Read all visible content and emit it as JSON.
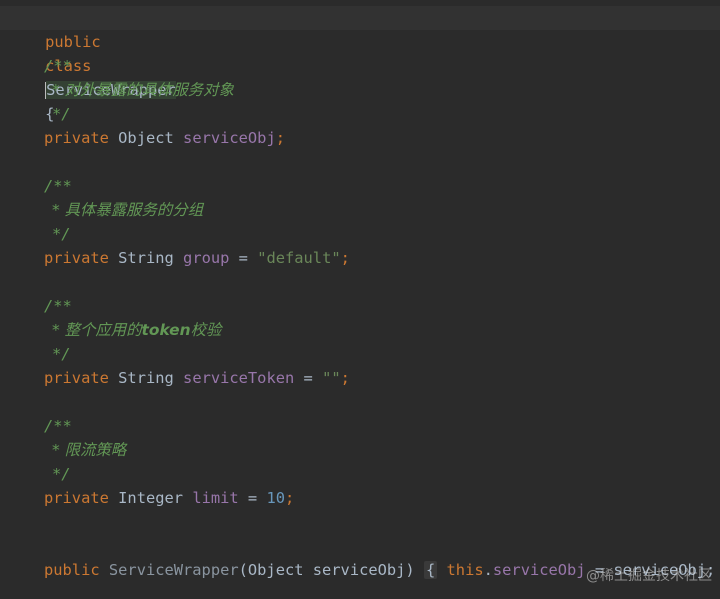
{
  "code": {
    "class_decl": {
      "kw_public": "public",
      "kw_class": "class",
      "class_name": "ServiceWrapper",
      "brace": "{"
    },
    "doc1": {
      "open": "/**",
      "text": "* 对外暴露的具体服务对象",
      "close": "*/"
    },
    "field1": {
      "modifier": "private",
      "type": "Object",
      "name": "serviceObj",
      "end": ";"
    },
    "doc2": {
      "open": "/**",
      "text": "* 具体暴露服务的分组",
      "close": "*/"
    },
    "field2": {
      "modifier": "private",
      "type": "String",
      "name": "group",
      "assign": " = ",
      "value": "\"default\"",
      "end": ";"
    },
    "doc3": {
      "open": "/**",
      "text_prefix": "* 整个应用的",
      "text_bold": "token",
      "text_suffix": "校验",
      "close": "*/"
    },
    "field3": {
      "modifier": "private",
      "type": "String",
      "name": "serviceToken",
      "assign": " = ",
      "value": "\"\"",
      "end": ";"
    },
    "doc4": {
      "open": "/**",
      "text": "* 限流策略",
      "close": "*/"
    },
    "field4": {
      "modifier": "private",
      "type": "Integer",
      "name": "limit",
      "assign": " = ",
      "value": "10",
      "end": ";"
    },
    "ctor": {
      "modifier": "public",
      "name": "ServiceWrapper",
      "params": "(Object serviceObj)",
      "fold_open": "{",
      "kw_this": "this",
      "dot": ".",
      "field": "serviceObj",
      "rest": " = serviceObj;",
      "fold_close": "}"
    }
  },
  "watermark": "@稀土掘金技术社区",
  "colors": {
    "background": "#2b2b2b",
    "keyword": "#cc7832",
    "field": "#9876aa",
    "string": "#6a8759",
    "number": "#6897bb",
    "doc_comment": "#629755",
    "plain": "#a9b7c6"
  }
}
